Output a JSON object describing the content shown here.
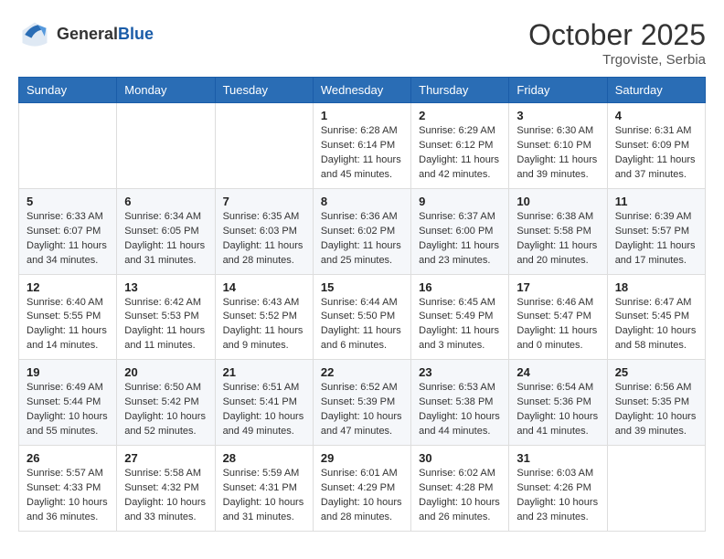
{
  "header": {
    "logo_general": "General",
    "logo_blue": "Blue",
    "month_year": "October 2025",
    "location": "Trgoviste, Serbia"
  },
  "weekdays": [
    "Sunday",
    "Monday",
    "Tuesday",
    "Wednesday",
    "Thursday",
    "Friday",
    "Saturday"
  ],
  "rows": [
    [
      {
        "day": "",
        "info": ""
      },
      {
        "day": "",
        "info": ""
      },
      {
        "day": "",
        "info": ""
      },
      {
        "day": "1",
        "info": "Sunrise: 6:28 AM\nSunset: 6:14 PM\nDaylight: 11 hours\nand 45 minutes."
      },
      {
        "day": "2",
        "info": "Sunrise: 6:29 AM\nSunset: 6:12 PM\nDaylight: 11 hours\nand 42 minutes."
      },
      {
        "day": "3",
        "info": "Sunrise: 6:30 AM\nSunset: 6:10 PM\nDaylight: 11 hours\nand 39 minutes."
      },
      {
        "day": "4",
        "info": "Sunrise: 6:31 AM\nSunset: 6:09 PM\nDaylight: 11 hours\nand 37 minutes."
      }
    ],
    [
      {
        "day": "5",
        "info": "Sunrise: 6:33 AM\nSunset: 6:07 PM\nDaylight: 11 hours\nand 34 minutes."
      },
      {
        "day": "6",
        "info": "Sunrise: 6:34 AM\nSunset: 6:05 PM\nDaylight: 11 hours\nand 31 minutes."
      },
      {
        "day": "7",
        "info": "Sunrise: 6:35 AM\nSunset: 6:03 PM\nDaylight: 11 hours\nand 28 minutes."
      },
      {
        "day": "8",
        "info": "Sunrise: 6:36 AM\nSunset: 6:02 PM\nDaylight: 11 hours\nand 25 minutes."
      },
      {
        "day": "9",
        "info": "Sunrise: 6:37 AM\nSunset: 6:00 PM\nDaylight: 11 hours\nand 23 minutes."
      },
      {
        "day": "10",
        "info": "Sunrise: 6:38 AM\nSunset: 5:58 PM\nDaylight: 11 hours\nand 20 minutes."
      },
      {
        "day": "11",
        "info": "Sunrise: 6:39 AM\nSunset: 5:57 PM\nDaylight: 11 hours\nand 17 minutes."
      }
    ],
    [
      {
        "day": "12",
        "info": "Sunrise: 6:40 AM\nSunset: 5:55 PM\nDaylight: 11 hours\nand 14 minutes."
      },
      {
        "day": "13",
        "info": "Sunrise: 6:42 AM\nSunset: 5:53 PM\nDaylight: 11 hours\nand 11 minutes."
      },
      {
        "day": "14",
        "info": "Sunrise: 6:43 AM\nSunset: 5:52 PM\nDaylight: 11 hours\nand 9 minutes."
      },
      {
        "day": "15",
        "info": "Sunrise: 6:44 AM\nSunset: 5:50 PM\nDaylight: 11 hours\nand 6 minutes."
      },
      {
        "day": "16",
        "info": "Sunrise: 6:45 AM\nSunset: 5:49 PM\nDaylight: 11 hours\nand 3 minutes."
      },
      {
        "day": "17",
        "info": "Sunrise: 6:46 AM\nSunset: 5:47 PM\nDaylight: 11 hours\nand 0 minutes."
      },
      {
        "day": "18",
        "info": "Sunrise: 6:47 AM\nSunset: 5:45 PM\nDaylight: 10 hours\nand 58 minutes."
      }
    ],
    [
      {
        "day": "19",
        "info": "Sunrise: 6:49 AM\nSunset: 5:44 PM\nDaylight: 10 hours\nand 55 minutes."
      },
      {
        "day": "20",
        "info": "Sunrise: 6:50 AM\nSunset: 5:42 PM\nDaylight: 10 hours\nand 52 minutes."
      },
      {
        "day": "21",
        "info": "Sunrise: 6:51 AM\nSunset: 5:41 PM\nDaylight: 10 hours\nand 49 minutes."
      },
      {
        "day": "22",
        "info": "Sunrise: 6:52 AM\nSunset: 5:39 PM\nDaylight: 10 hours\nand 47 minutes."
      },
      {
        "day": "23",
        "info": "Sunrise: 6:53 AM\nSunset: 5:38 PM\nDaylight: 10 hours\nand 44 minutes."
      },
      {
        "day": "24",
        "info": "Sunrise: 6:54 AM\nSunset: 5:36 PM\nDaylight: 10 hours\nand 41 minutes."
      },
      {
        "day": "25",
        "info": "Sunrise: 6:56 AM\nSunset: 5:35 PM\nDaylight: 10 hours\nand 39 minutes."
      }
    ],
    [
      {
        "day": "26",
        "info": "Sunrise: 5:57 AM\nSunset: 4:33 PM\nDaylight: 10 hours\nand 36 minutes."
      },
      {
        "day": "27",
        "info": "Sunrise: 5:58 AM\nSunset: 4:32 PM\nDaylight: 10 hours\nand 33 minutes."
      },
      {
        "day": "28",
        "info": "Sunrise: 5:59 AM\nSunset: 4:31 PM\nDaylight: 10 hours\nand 31 minutes."
      },
      {
        "day": "29",
        "info": "Sunrise: 6:01 AM\nSunset: 4:29 PM\nDaylight: 10 hours\nand 28 minutes."
      },
      {
        "day": "30",
        "info": "Sunrise: 6:02 AM\nSunset: 4:28 PM\nDaylight: 10 hours\nand 26 minutes."
      },
      {
        "day": "31",
        "info": "Sunrise: 6:03 AM\nSunset: 4:26 PM\nDaylight: 10 hours\nand 23 minutes."
      },
      {
        "day": "",
        "info": ""
      }
    ]
  ]
}
